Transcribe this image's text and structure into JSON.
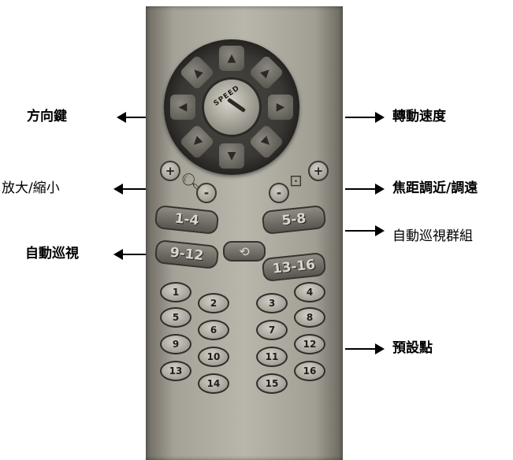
{
  "labels": {
    "direction_keys": "方向鍵",
    "zoom": "放大/縮小",
    "auto_patrol": "自動巡視",
    "rotation_speed": "轉動速度",
    "focus": "焦距調近/調遠",
    "patrol_group": "自動巡視群組",
    "presets": "預設點"
  },
  "remote": {
    "speed_label": "SPEED",
    "zoom_in": "+",
    "zoom_out": "-",
    "focus_near": "-",
    "focus_far": "+",
    "group_1_4": "1-4",
    "group_5_8": "5-8",
    "group_9_12": "9-12",
    "group_13_16": "13-16",
    "cycle_symbol": "⟲",
    "presets": [
      "1",
      "2",
      "3",
      "4",
      "5",
      "6",
      "7",
      "8",
      "9",
      "10",
      "11",
      "12",
      "13",
      "14",
      "15",
      "16"
    ]
  }
}
